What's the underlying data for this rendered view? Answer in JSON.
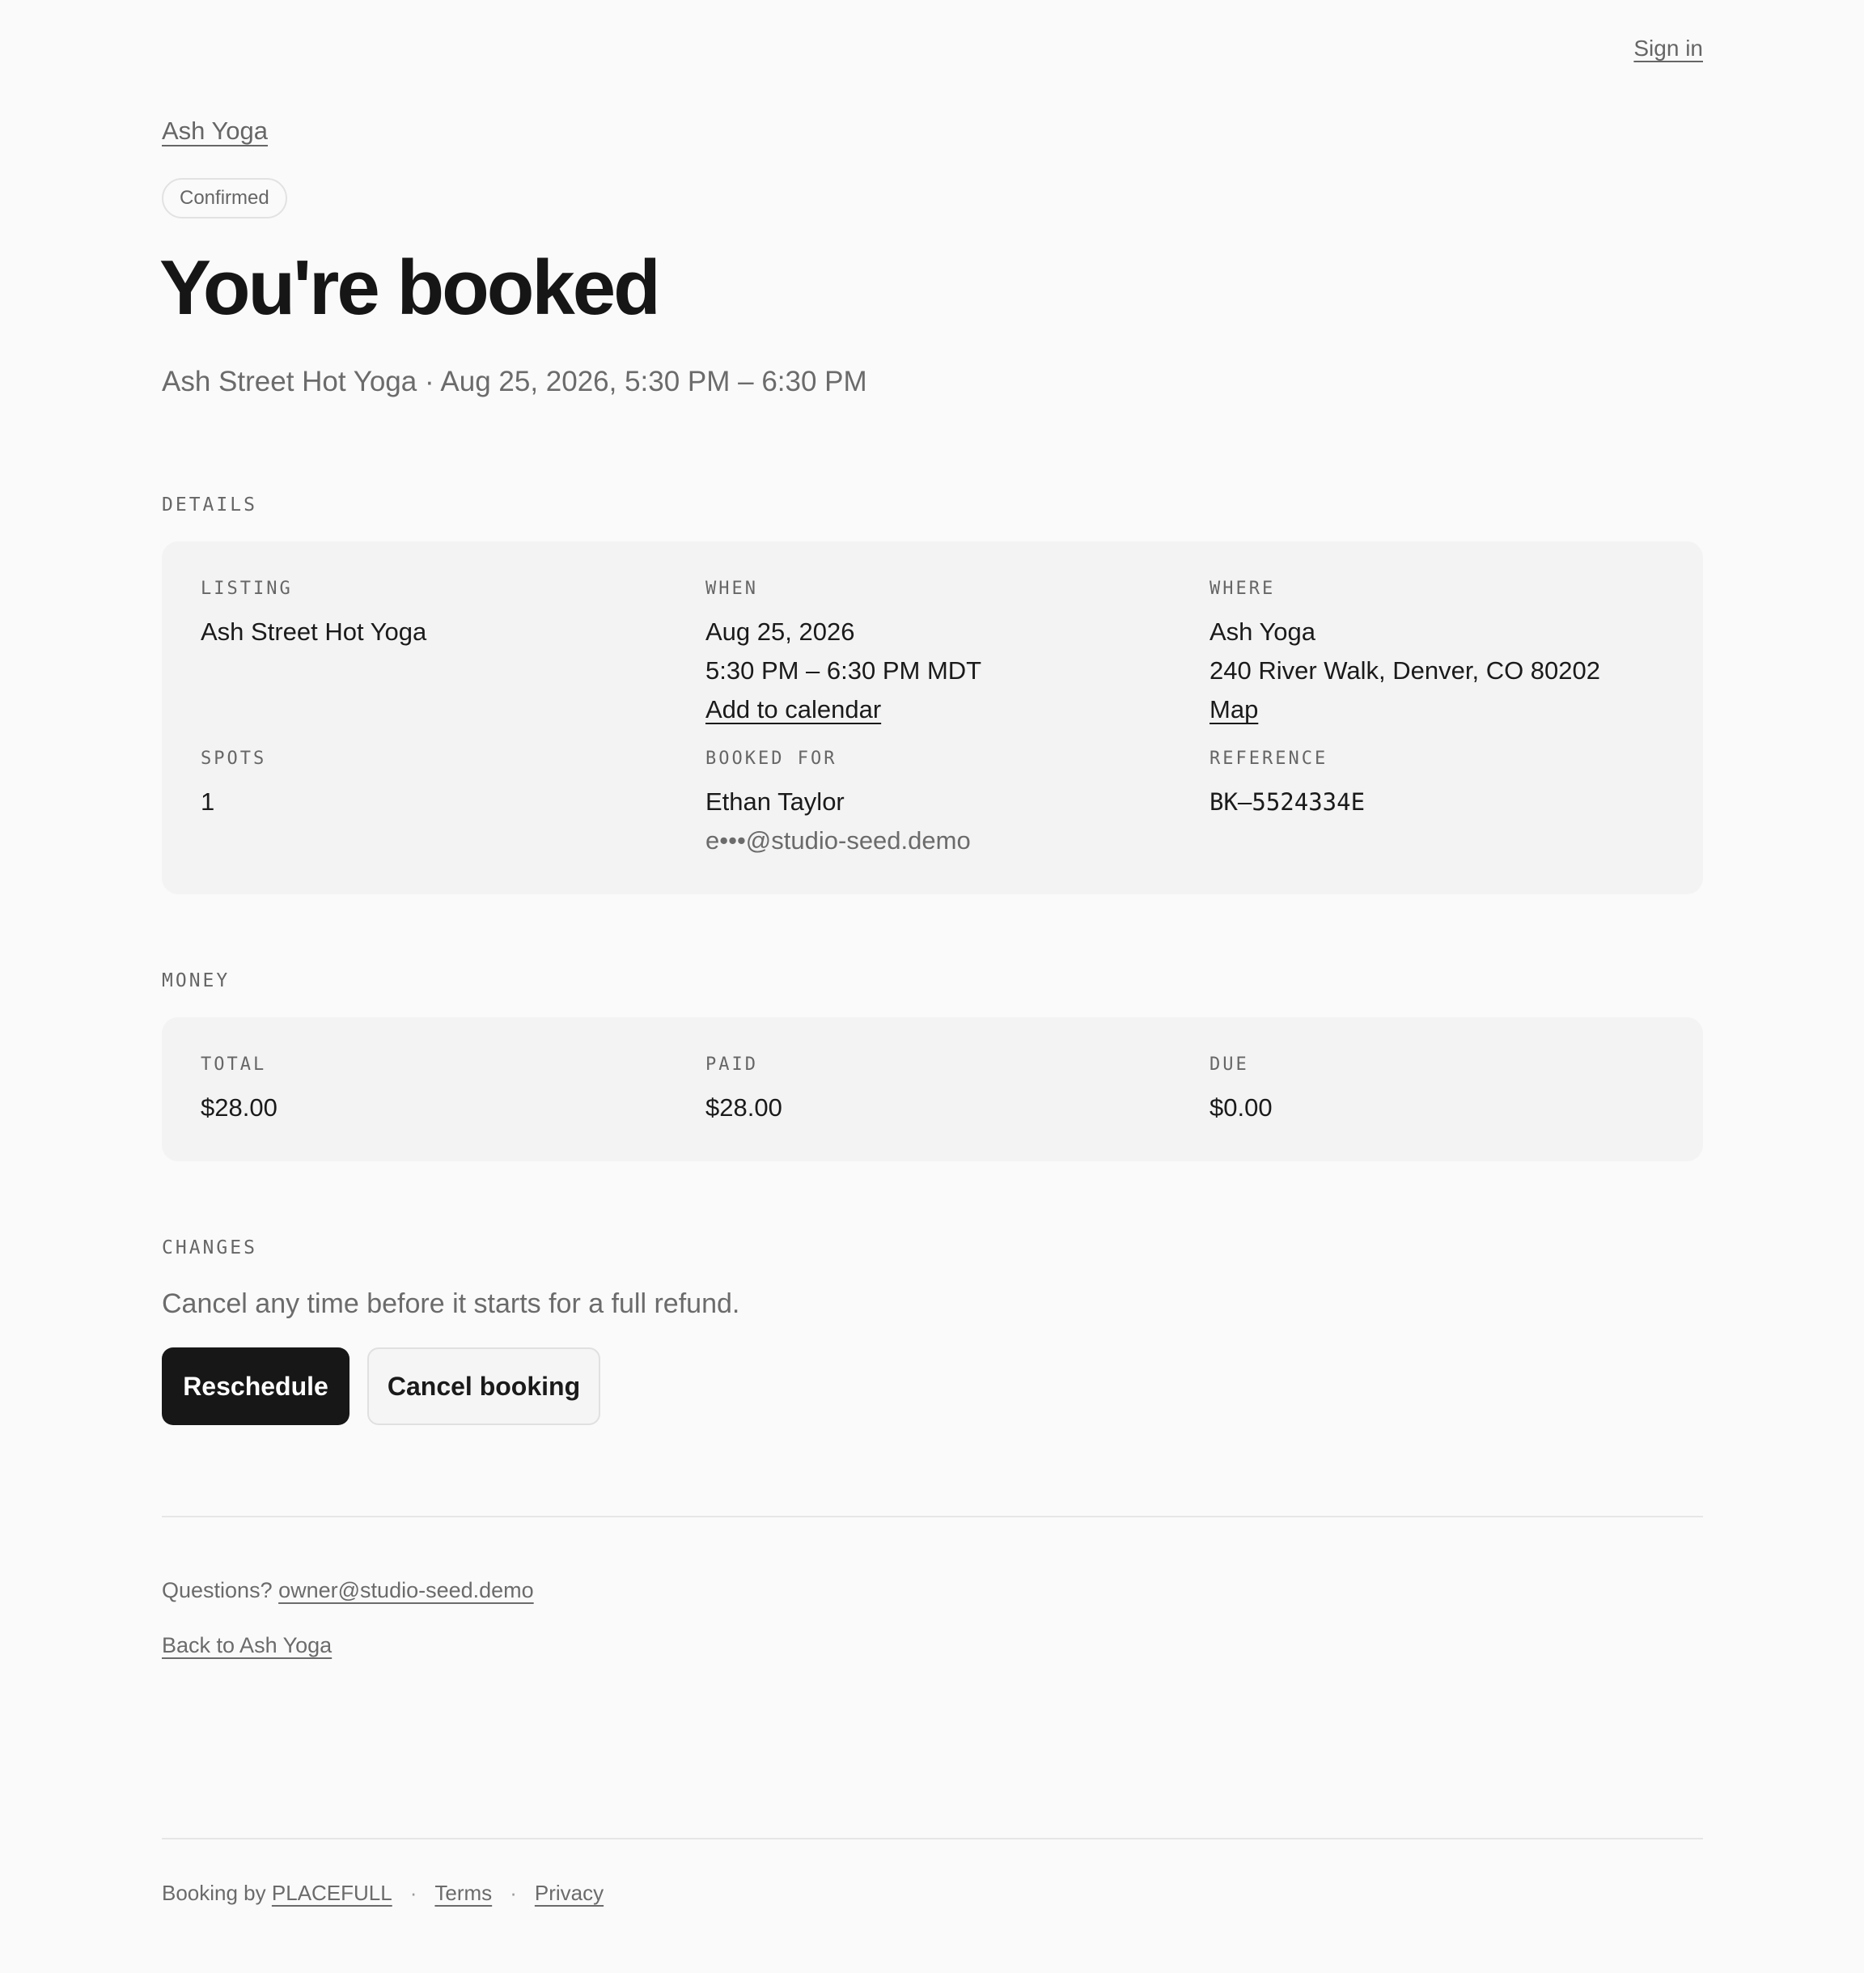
{
  "header": {
    "sign_in": "Sign in"
  },
  "brand": {
    "name_link": "Ash Yoga"
  },
  "status": {
    "badge": "Confirmed"
  },
  "hero": {
    "title": "You're booked",
    "subtitle": "Ash Street Hot Yoga · Aug 25, 2026, 5:30 PM – 6:30 PM"
  },
  "details": {
    "section_label": "DETAILS",
    "listing": {
      "label": "LISTING",
      "value": "Ash Street Hot Yoga"
    },
    "when": {
      "label": "WHEN",
      "date": "Aug 25, 2026",
      "time": "5:30 PM – 6:30 PM MDT",
      "calendar_link": "Add to calendar"
    },
    "where": {
      "label": "WHERE",
      "venue": "Ash Yoga",
      "address": "240 River Walk, Denver, CO 80202",
      "map_link": "Map"
    },
    "spots": {
      "label": "SPOTS",
      "value": "1"
    },
    "booked_for": {
      "label": "BOOKED FOR",
      "name": "Ethan Taylor",
      "email": "e•••@studio-seed.demo"
    },
    "reference": {
      "label": "REFERENCE",
      "value": "BK–5524334E"
    }
  },
  "money": {
    "section_label": "MONEY",
    "total": {
      "label": "TOTAL",
      "value": "$28.00"
    },
    "paid": {
      "label": "PAID",
      "value": "$28.00"
    },
    "due": {
      "label": "DUE",
      "value": "$0.00"
    }
  },
  "changes": {
    "section_label": "CHANGES",
    "policy": "Cancel any time before it starts for a full refund.",
    "reschedule_label": "Reschedule",
    "cancel_label": "Cancel booking"
  },
  "contact": {
    "prefix": "Questions?",
    "email": "owner@studio-seed.demo",
    "back_link": "Back to Ash Yoga"
  },
  "footer": {
    "prefix": "Booking by",
    "brand": "PLACEFULL",
    "separator": "·",
    "terms": "Terms",
    "privacy": "Privacy"
  },
  "colors": {
    "background": "#fafafa",
    "panel": "#f3f3f3",
    "primary_button": "#171717",
    "text": "#1a1a1a",
    "muted_text": "#6b6b6b"
  }
}
